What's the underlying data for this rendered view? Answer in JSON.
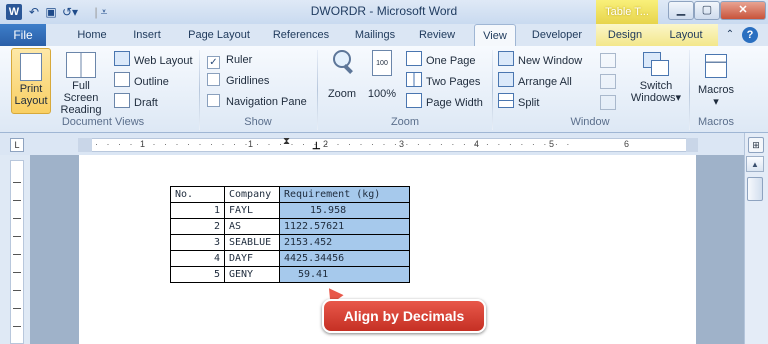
{
  "window": {
    "title": "DWORDR - Microsoft Word",
    "app_icon": "W",
    "context_tab": "Table T...",
    "controls": [
      "minimize-icon",
      "maximize-icon",
      "close-icon"
    ]
  },
  "quick_access": [
    "undo-icon",
    "redo-icon",
    "save-icon",
    "customize-icon"
  ],
  "tabs": [
    {
      "label": "File"
    },
    {
      "label": "Home"
    },
    {
      "label": "Insert"
    },
    {
      "label": "Page Layout"
    },
    {
      "label": "References"
    },
    {
      "label": "Mailings"
    },
    {
      "label": "Review"
    },
    {
      "label": "View",
      "active": true
    },
    {
      "label": "Developer"
    },
    {
      "label": "Design"
    },
    {
      "label": "Layout"
    }
  ],
  "ribbon": {
    "document_views": {
      "label": "Document Views",
      "print_layout": "Print Layout",
      "print_layout_l1": "Print",
      "print_layout_l2": "Layout",
      "full_screen_l1": "Full Screen",
      "full_screen_l2": "Reading",
      "web_layout": "Web Layout",
      "outline": "Outline",
      "draft": "Draft"
    },
    "show": {
      "label": "Show",
      "ruler": "Ruler",
      "ruler_checked": true,
      "gridlines": "Gridlines",
      "gridlines_checked": false,
      "navigation_pane": "Navigation Pane",
      "navigation_pane_checked": false
    },
    "zoom": {
      "label": "Zoom",
      "zoom": "Zoom",
      "hundred": "100%",
      "one_page": "One Page",
      "two_pages": "Two Pages",
      "page_width": "Page Width"
    },
    "window_group": {
      "label": "Window",
      "new_window": "New Window",
      "arrange_all": "Arrange All",
      "split": "Split",
      "switch_windows_l1": "Switch",
      "switch_windows_l2": "Windows"
    },
    "macros": {
      "label": "Macros",
      "macros": "Macros"
    }
  },
  "ruler": {
    "numbers": [
      "1",
      "1",
      "2",
      "3",
      "4",
      "5",
      "6"
    ]
  },
  "table": {
    "headers": [
      "No.",
      "Company",
      "Requirement (kg)"
    ],
    "rows": [
      [
        "1",
        "FAYL",
        "15.958"
      ],
      [
        "2",
        "AS",
        "1122.57621"
      ],
      [
        "3",
        "SEABLUE",
        "2153.452"
      ],
      [
        "4",
        "DAYF",
        "4425.34456"
      ],
      [
        "5",
        "GENY",
        "59.41"
      ]
    ]
  },
  "callout": {
    "text": "Align by Decimals"
  },
  "colors": {
    "accent": "#2a5fa8",
    "selection": "#a6c9ec",
    "callout": "#d9382b",
    "context_tab": "#e7d44c"
  }
}
